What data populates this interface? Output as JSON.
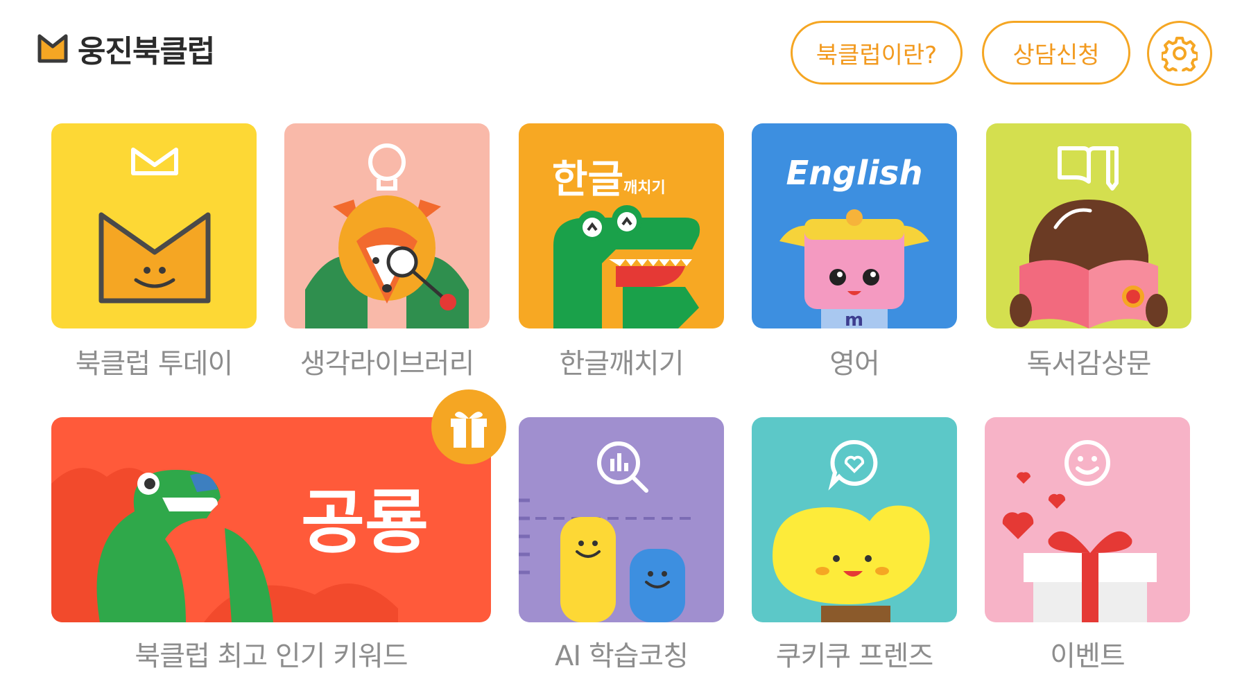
{
  "header": {
    "app_title": "웅진북클럽",
    "about_button": "북클럽이란?",
    "consult_button": "상담신청",
    "logo_icon": "bookclub-logo-icon",
    "settings_icon": "gear-icon",
    "accent_color": "#f5a623"
  },
  "tiles_row1": [
    {
      "label": "북클럽 투데이",
      "icon": "bookclub-basket-icon",
      "color": "#fdd835"
    },
    {
      "label": "생각라이브러리",
      "icon": "lightbulb-icon",
      "color": "#f9b9a9"
    },
    {
      "label": "한글깨치기",
      "icon": "crocodile-illustration",
      "color": "#f7a823",
      "art_text": "한글",
      "art_small": "깨치기"
    },
    {
      "label": "영어",
      "icon": "girl-illustration",
      "color": "#3d8fe0",
      "art_text": "English"
    },
    {
      "label": "독서감상문",
      "icon": "book-pencil-icon",
      "color": "#d4df4f"
    }
  ],
  "tiles_row2": [
    {
      "label": "북클럽 최고 인기 키워드",
      "icon": "dinosaur-illustration",
      "color": "#ff5a3a",
      "art_text": "공룡",
      "badge_icon": "gift-icon"
    },
    {
      "label": "AI 학습코칭",
      "icon": "chart-magnifier-icon",
      "color": "#a08fcf"
    },
    {
      "label": "쿠키쿠 프렌즈",
      "icon": "heart-chat-icon",
      "color": "#5cc8c8"
    },
    {
      "label": "이벤트",
      "icon": "smiley-icon",
      "color": "#f7b3c7"
    }
  ]
}
